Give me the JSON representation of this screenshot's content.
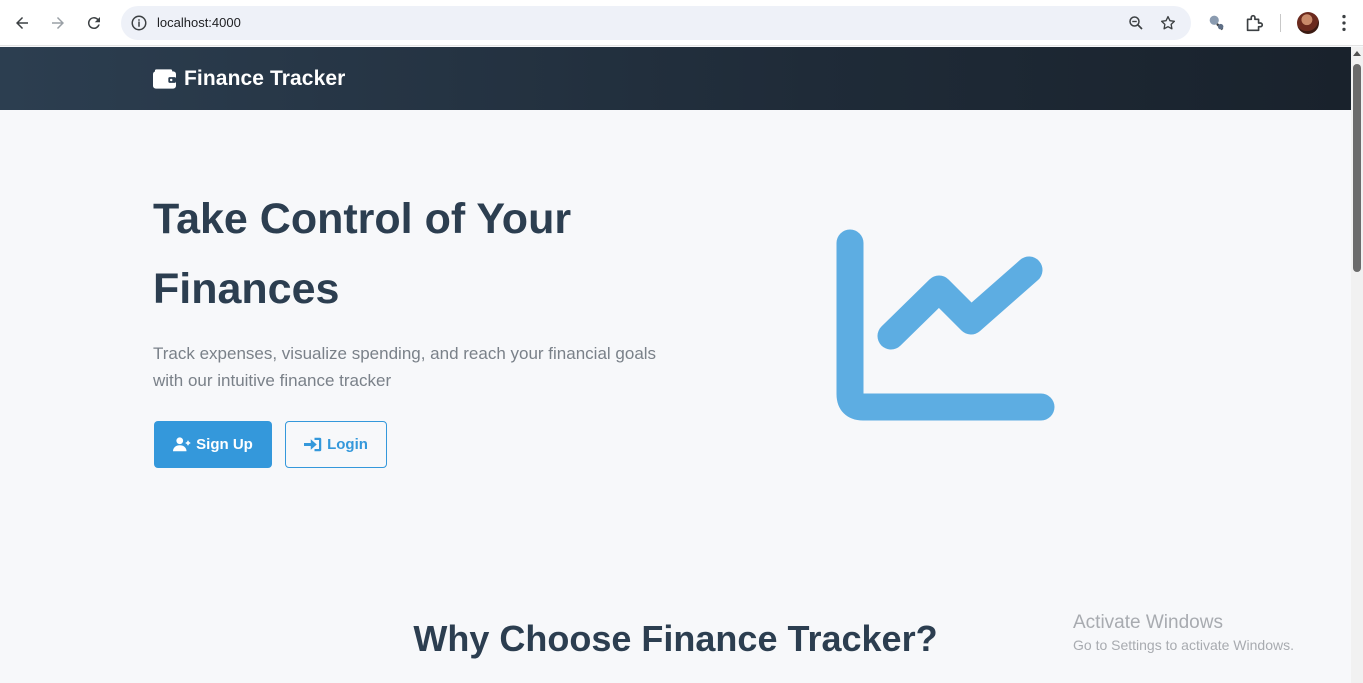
{
  "browser": {
    "url": "localhost:4000",
    "icons": [
      "back-arrow-icon",
      "forward-arrow-icon",
      "reload-icon",
      "info-icon",
      "zoom-icon",
      "star-icon",
      "extension-puzzle-icon",
      "profile-avatar",
      "kebab-menu-icon"
    ]
  },
  "navbar": {
    "brand": "Finance Tracker",
    "brand_icon": "wallet-icon"
  },
  "hero": {
    "title": "Take Control of Your Finances",
    "subtitle": "Track expenses, visualize spending, and reach your financial goals with our intuitive finance tracker",
    "signup_label": "Sign Up",
    "signup_icon": "user-plus-icon",
    "login_label": "Login",
    "login_icon": "sign-in-icon",
    "graphic_icon": "line-chart-icon"
  },
  "features": {
    "title": "Why Choose Finance Tracker?"
  },
  "watermark": {
    "title": "Activate Windows",
    "subtitle": "Go to Settings to activate Windows."
  },
  "colors": {
    "primary": "#3498db",
    "navbar": "#2c3e50",
    "heading": "#2c3e50",
    "background": "#f7f8fa"
  }
}
